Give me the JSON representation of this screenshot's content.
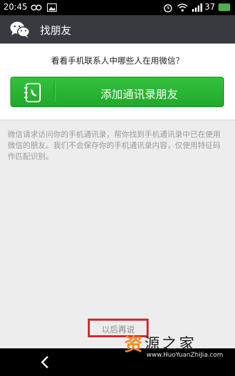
{
  "status_bar": {
    "time": "20:45",
    "battery": "37",
    "icons": [
      "infinity-icon",
      "image-icon",
      "alarm-icon",
      "wifi-icon",
      "signal-icon",
      "battery-icon"
    ]
  },
  "header": {
    "title": "找朋友",
    "logo_icon": "wechat-logo-icon"
  },
  "main": {
    "prompt": "看看手机联系人中哪些人在用微信？",
    "add_button_label": "添加通讯录朋友",
    "add_button_icon": "address-book-icon",
    "description": "微信请求访问你的手机通讯录，帮你找到手机通讯录中已在使用微信的朋友。我们不会保存你的手机通讯录内容，仅使用特征码作匹配识别。",
    "later_button_label": "以后再说"
  },
  "nav_bar": {
    "back_icon": "back-chevron-icon"
  },
  "watermark": {
    "brand_char": "资",
    "brand_text": "源之家",
    "url": "www.HuoYuanZhiJia.com"
  },
  "colors": {
    "accent_green": "#22a82c",
    "header_bg": "#393a3f",
    "highlight_red": "#d9262f"
  }
}
